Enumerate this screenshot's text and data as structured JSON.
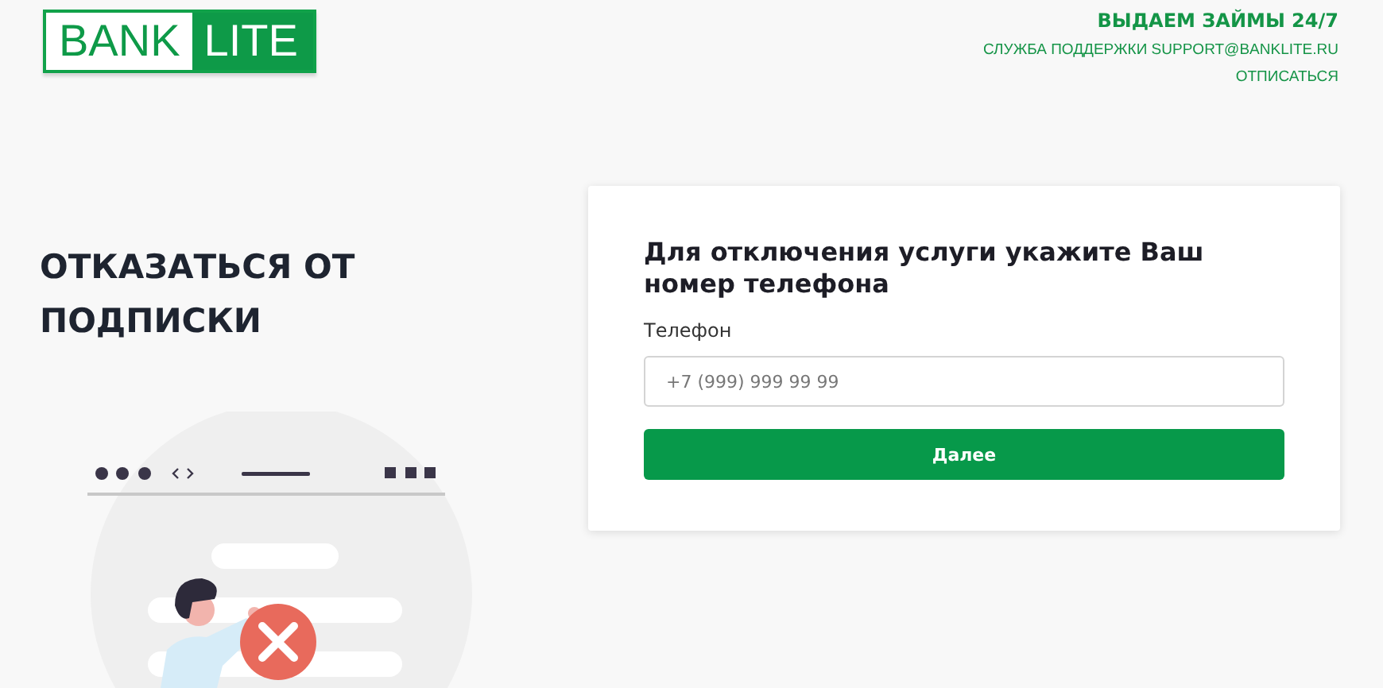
{
  "logo": {
    "part_1": "BANK",
    "part_2": "LITE"
  },
  "header": {
    "slogan": "ВЫДАЕМ ЗАЙМЫ 24/7",
    "support": "СЛУЖБА ПОДДЕРЖКИ SUPPORT@BANKLITE.RU",
    "unsubscribe_link": "ОТПИСАТЬСЯ"
  },
  "heading": "ОТКАЗАТЬСЯ ОТ ПОДПИСКИ",
  "form": {
    "title": "Для отключения услуги укажите Ваш номер телефона",
    "phone_label": "Телефон",
    "phone_placeholder": "+7 (999) 999 99 99",
    "submit": "Далее"
  }
}
